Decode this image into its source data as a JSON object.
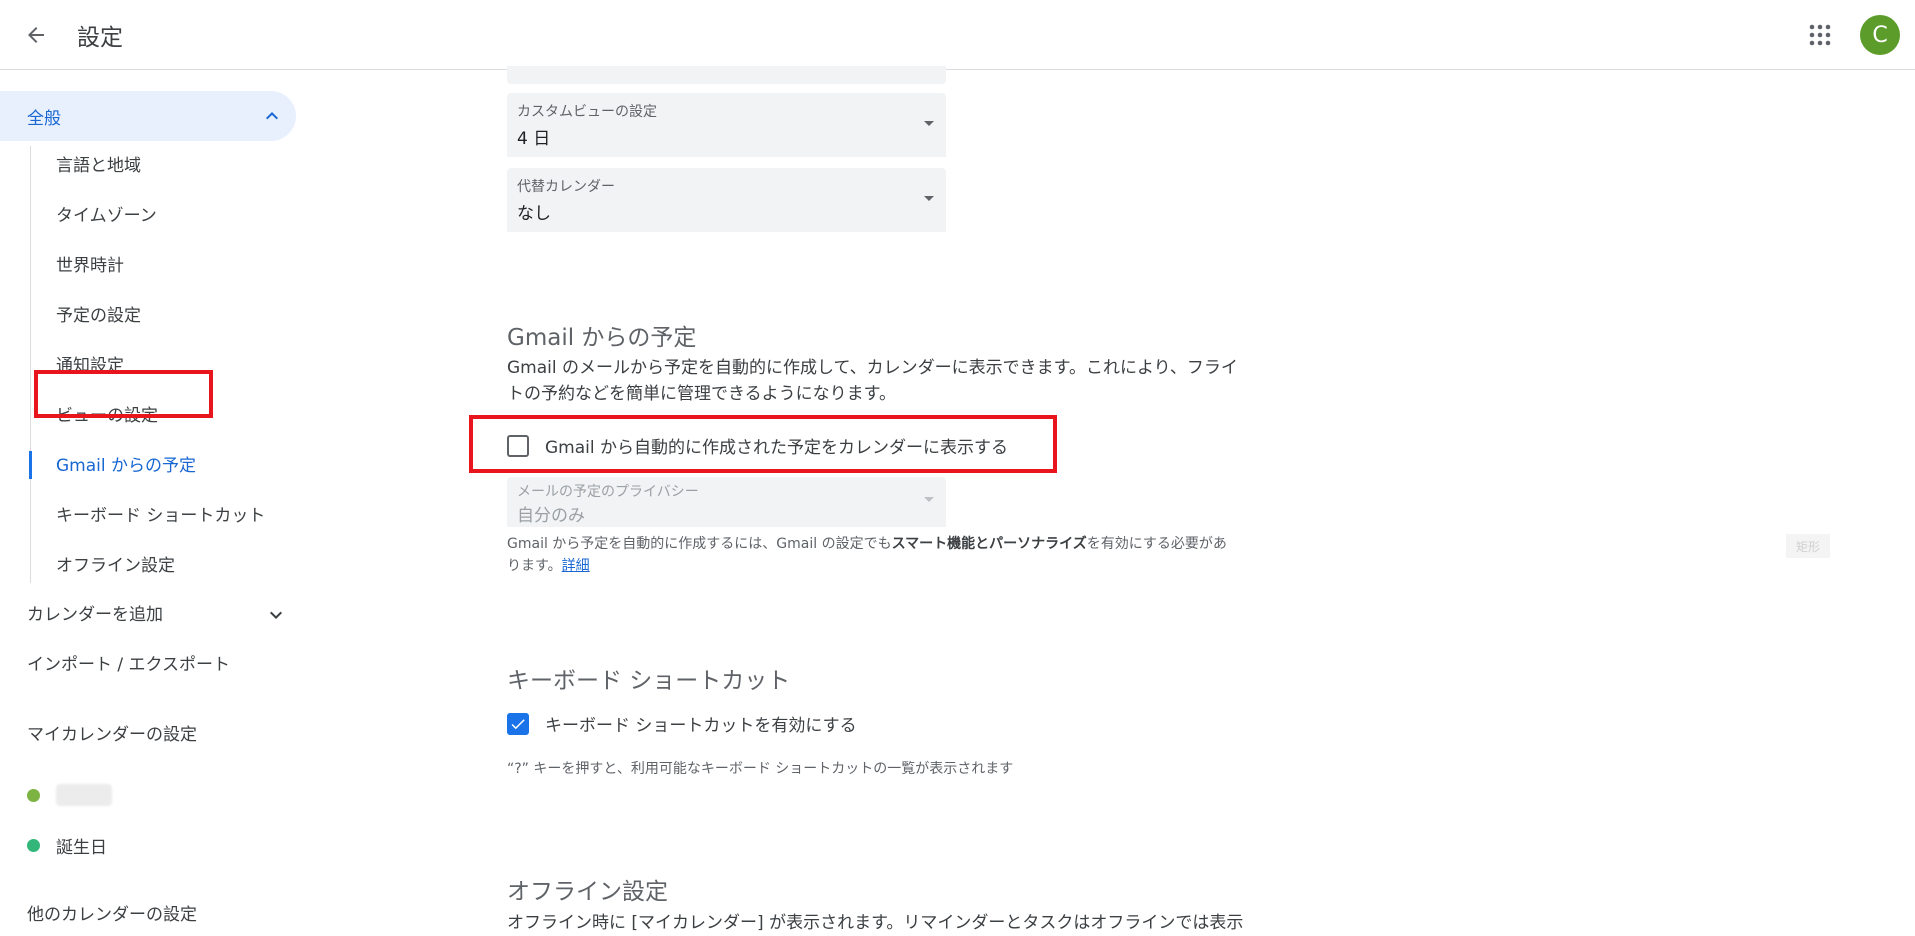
{
  "header": {
    "title": "設定",
    "avatar_letter": "C"
  },
  "sidebar": {
    "general_label": "全般",
    "general_items": [
      {
        "label": "言語と地域"
      },
      {
        "label": "タイムゾーン"
      },
      {
        "label": "世界時計"
      },
      {
        "label": "予定の設定"
      },
      {
        "label": "通知設定"
      },
      {
        "label": "ビューの設定"
      },
      {
        "label": "Gmail からの予定",
        "active": true
      },
      {
        "label": "キーボード ショートカット"
      },
      {
        "label": "オフライン設定"
      }
    ],
    "add_calendar": "カレンダーを追加",
    "import_export": "インポート / エクスポート",
    "my_calendars_header": "マイカレンダーの設定",
    "my_calendars": [
      {
        "label": "",
        "color": "#7cb342",
        "blurred": true
      },
      {
        "label": "誕生日",
        "color": "#33b679"
      }
    ],
    "other_calendars_header": "他のカレンダーの設定"
  },
  "main": {
    "custom_view": {
      "label": "カスタムビューの設定",
      "value": "4 日"
    },
    "alt_calendar": {
      "label": "代替カレンダー",
      "value": "なし"
    },
    "gmail_section": {
      "title": "Gmail からの予定",
      "desc_line1": "Gmail のメールから予定を自動的に作成して、カレンダーに表示できます。これにより、フライ",
      "desc_line2": "トの予約などを簡単に管理できるようになります。",
      "checkbox_label": "Gmail から自動的に作成された予定をカレンダーに表示する",
      "checkbox_checked": false,
      "privacy_label": "メールの予定のプライバシー",
      "privacy_value": "自分のみ",
      "note_part1": "Gmail から予定を自動的に作成するには、Gmail の設定でも",
      "note_bold": "スマート機能とパーソナライズ",
      "note_part2": "を有効にする必要があ",
      "note_line2": "ります。",
      "note_link": "詳細"
    },
    "keyboard_section": {
      "title": "キーボード ショートカット",
      "checkbox_label": "キーボード ショートカットを有効にする",
      "checkbox_checked": true,
      "hint": "“?” キーを押すと、利用可能なキーボード ショートカットの一覧が表示されます"
    },
    "offline_section": {
      "title": "オフライン設定",
      "desc": "オフライン時に [マイカレンダー] が表示されます。リマインダーとタスクはオフラインでは表示"
    },
    "ghost_tag": "矩形"
  },
  "colors": {
    "accent": "#1a73e8",
    "highlight": "#e8161c",
    "avatar": "#5b9c2a"
  }
}
